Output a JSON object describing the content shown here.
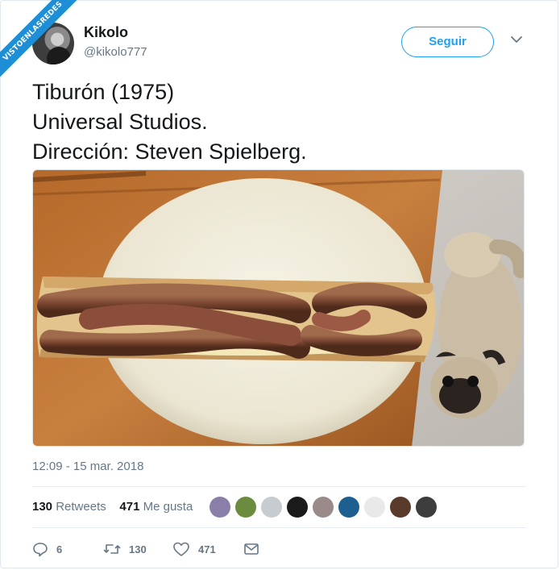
{
  "watermark": "VISTOENLASREDES",
  "author": {
    "name": "Kikolo",
    "handle": "@kikolo777"
  },
  "follow_label": "Seguir",
  "tweet_lines": [
    "Tiburón (1975)",
    "Universal Studios.",
    "Dirección: Steven Spielberg."
  ],
  "timestamp": "12:09 - 15 mar. 2018",
  "stats": {
    "retweets_count": "130",
    "retweets_label": "Retweets",
    "likes_count": "471",
    "likes_label": "Me gusta"
  },
  "likers": [
    "#8a7fa8",
    "#6b8c3f",
    "#c7ccd1",
    "#1b1b1b",
    "#9a8a8a",
    "#1d5f8f",
    "#e9e9e9",
    "#5a3a2a",
    "#3d3d3d"
  ],
  "actions": {
    "replies": "6",
    "retweets": "130",
    "likes": "471"
  },
  "colors": {
    "accent": "#1da1f2",
    "muted": "#657786",
    "text": "#14171a",
    "ribbon": "#1e8fd6"
  },
  "icons": [
    "chevron-down-icon",
    "reply-icon",
    "retweet-icon",
    "heart-icon",
    "mail-icon"
  ]
}
